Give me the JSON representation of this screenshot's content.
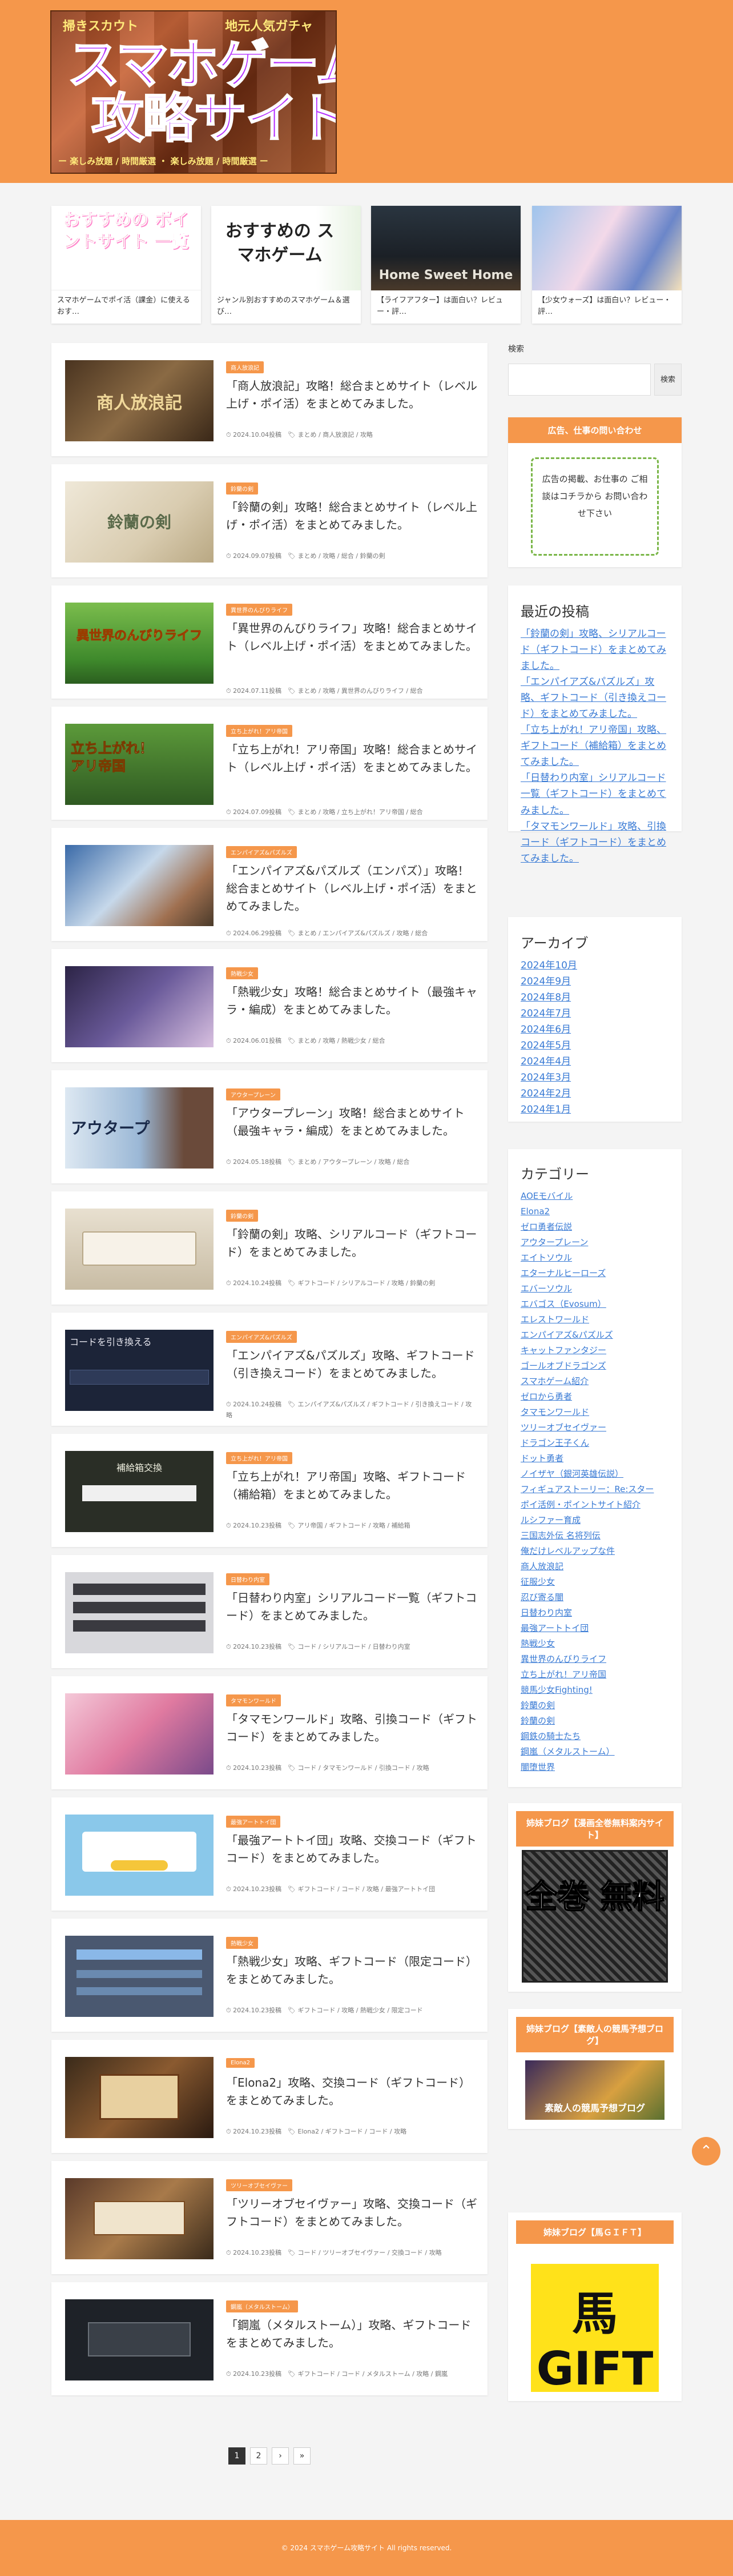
{
  "header": {
    "logo_top_left": "掃きスカウト",
    "logo_top_right": "地元人気ガチャ",
    "logo_title_line1": "スマホゲーム",
    "logo_title_line2": "攻略サイト",
    "logo_bottom": "ー 楽しみ放題 / 時間厳選 ・ 楽しみ放題 / 時間厳選 ー"
  },
  "carousel": [
    {
      "caption": "スマホゲームでポイ活（課金）に使えるおす…",
      "img_text": "おすすめの ポイントサイト 一覧"
    },
    {
      "caption": "ジャンル別おすすめのスマホゲーム＆選び…",
      "img_text": "おすすめの スマホゲーム"
    },
    {
      "caption": "【ライフアフター】は面白い？レビュー・評…",
      "img_text": "Home Sweet Home"
    },
    {
      "caption": "【少女ウォーズ】は面白い？レビュー・評…",
      "img_text": ""
    }
  ],
  "posts": [
    {
      "badge": "商人放浪記",
      "title": "「商人放浪記」攻略！総合まとめサイト（レベル上げ・ポイ活）をまとめてみました。",
      "date": "2024.10.04投稿",
      "tags": "まとめ / 商人放浪記 / 攻略",
      "thumb": "商人放浪記"
    },
    {
      "badge": "鈴蘭の剣",
      "title": "「鈴蘭の剣」攻略！総合まとめサイト（レベル上げ・ポイ活）をまとめてみました。",
      "date": "2024.09.07投稿",
      "tags": "まとめ / 攻略 / 総合 / 鈴蘭の剣",
      "thumb": "鈴蘭の剣"
    },
    {
      "badge": "異世界のんびりライフ",
      "title": "「異世界のんびりライフ」攻略！総合まとめサイト（レベル上げ・ポイ活）をまとめてみました。",
      "date": "2024.07.11投稿",
      "tags": "まとめ / 攻略 / 異世界のんびりライフ / 総合",
      "thumb": "異世界のんびりライフ"
    },
    {
      "badge": "立ち上がれ！アリ帝国",
      "title": "「立ち上がれ！アリ帝国」攻略！総合まとめサイト（レベル上げ・ポイ活）をまとめてみました。",
      "date": "2024.07.09投稿",
      "tags": "まとめ / 攻略 / 立ち上がれ！アリ帝国 / 総合",
      "thumb": "立ち上がれ！アリ帝国"
    },
    {
      "badge": "エンパイアズ&パズルズ",
      "title": "「エンパイアズ&パズルズ（エンパズ）」攻略！総合まとめサイト（レベル上げ・ポイ活）をまとめてみました。",
      "date": "2024.06.29投稿",
      "tags": "まとめ / エンパイアズ&パズルズ / 攻略 / 総合",
      "thumb": ""
    },
    {
      "badge": "熱戦少女",
      "title": "「熱戦少女」攻略！総合まとめサイト（最強キャラ・編成）をまとめてみました。",
      "date": "2024.06.01投稿",
      "tags": "まとめ / 攻略 / 熱戦少女 / 総合",
      "thumb": ""
    },
    {
      "badge": "アウタープレーン",
      "title": "「アウタープレーン」攻略！総合まとめサイト（最強キャラ・編成）をまとめてみました。",
      "date": "2024.05.18投稿",
      "tags": "まとめ / アウタープレーン / 攻略 / 総合",
      "thumb": "アウタープ"
    },
    {
      "badge": "鈴蘭の剣",
      "title": "「鈴蘭の剣」攻略、シリアルコード（ギフトコード）をまとめてみました。",
      "date": "2024.10.24投稿",
      "tags": "ギフトコード / シリアルコード / 攻略 / 鈴蘭の剣",
      "thumb": ""
    },
    {
      "badge": "エンパイアズ&パズルズ",
      "title": "「エンパイアズ&パズルズ」攻略、ギフトコード（引き換えコード）をまとめてみました。",
      "date": "2024.10.24投稿",
      "tags": "エンパイアズ&パズルズ / ギフトコード / 引き換えコード / 攻略",
      "thumb": "コードを引き換える"
    },
    {
      "badge": "立ち上がれ！アリ帝国",
      "title": "「立ち上がれ！アリ帝国」攻略、ギフトコード（補給箱）をまとめてみました。",
      "date": "2024.10.23投稿",
      "tags": "アリ帝国 / ギフトコード / 攻略 / 補給箱",
      "thumb": "補給箱交換"
    },
    {
      "badge": "日替わり内室",
      "title": "「日替わり内室」シリアルコード一覧（ギフトコード）をまとめてみました。",
      "date": "2024.10.23投稿",
      "tags": "コード / シリアルコード / 日替わり内室",
      "thumb": ""
    },
    {
      "badge": "タマモンワールド",
      "title": "「タマモンワールド」攻略、引換コード（ギフトコード）をまとめてみました。",
      "date": "2024.10.23投稿",
      "tags": "コード / タマモンワールド / 引換コード / 攻略",
      "thumb": ""
    },
    {
      "badge": "最強アートトイ団",
      "title": "「最強アートトイ団」攻略、交換コード（ギフトコード）をまとめてみました。",
      "date": "2024.10.23投稿",
      "tags": "ギフトコード / コード / 攻略 / 最強アートトイ団",
      "thumb": ""
    },
    {
      "badge": "熱戦少女",
      "title": "「熱戦少女」攻略、ギフトコード（限定コード）をまとめてみました。",
      "date": "2024.10.23投稿",
      "tags": "ギフトコード / 攻略 / 熱戦少女 / 限定コード",
      "thumb": ""
    },
    {
      "badge": "Elona2",
      "title": "「Elona2」攻略、交換コード（ギフトコード）をまとめてみました。",
      "date": "2024.10.23投稿",
      "tags": "Elona2 / ギフトコード / コード / 攻略",
      "thumb": ""
    },
    {
      "badge": "ツリーオブセイヴァー",
      "title": "「ツリーオブセイヴァー」攻略、交換コード（ギフトコード）をまとめてみました。",
      "date": "2024.10.23投稿",
      "tags": "コード / ツリーオブセイヴァー / 交換コード / 攻略",
      "thumb": ""
    },
    {
      "badge": "鋼嵐（メタルストーム）",
      "title": "「鋼嵐（メタルストーム）」攻略、ギフトコードをまとめてみました。",
      "date": "2024.10.23投稿",
      "tags": "ギフトコード / コード / メタルストーム / 攻略 / 鋼嵐",
      "thumb": ""
    }
  ],
  "sidebar": {
    "search_label": "検索",
    "search_button": "検索",
    "contact_header": "広告、仕事の問い合わせ",
    "contact_text": "広告の掲載、お仕事の ご相談はコチラから お問い合わせ下さい",
    "recent_title": "最近の投稿",
    "recent": [
      "「鈴蘭の剣」攻略、シリアルコード（ギフトコード）をまとめてみました。",
      "「エンパイアズ&パズルズ」攻略、ギフトコード（引き換えコード）をまとめてみました。",
      "「立ち上がれ！アリ帝国」攻略、ギフトコード（補給箱）をまとめてみました。",
      "「日替わり内室」シリアルコード一覧（ギフトコード）をまとめてみました。",
      "「タマモンワールド」攻略、引換コード（ギフトコード）をまとめてみました。"
    ],
    "archive_title": "アーカイブ",
    "archives": [
      "2024年10月",
      "2024年9月",
      "2024年8月",
      "2024年7月",
      "2024年6月",
      "2024年5月",
      "2024年4月",
      "2024年3月",
      "2024年2月",
      "2024年1月"
    ],
    "category_title": "カテゴリー",
    "categories": [
      "AOEモバイル",
      "Elona2",
      "ゼロ勇者伝説",
      "アウタープレーン",
      "エイトソウル",
      "エターナルヒーローズ",
      "エバーソウル",
      "エバゴス（Evosum）",
      "エレストワールド",
      "エンパイアズ&パズルズ",
      "キャットファンタジー",
      "ゴールオブドラゴンズ",
      "スマホゲーム紹介",
      "ゼロから勇者",
      "タマモンワールド",
      "ツリーオブセイヴァー",
      "ドラゴン王子くん",
      "ドット勇者",
      "ノイザヤ（銀河英雄伝説）",
      "フィギュアストーリー：Re:スター",
      "ポイ活例・ポイントサイト紹介",
      "ルシファー育成",
      "三国志外伝 名将列伝",
      "俺だけレベルアップな件",
      "商人放浪記",
      "征服少女",
      "忍び寄る闇",
      "日替わり内室",
      "最強アートトイ団",
      "熱戦少女",
      "異世界のんびりライフ",
      "立ち上がれ！アリ帝国",
      "競馬少女Fighting!",
      "鈴蘭の剣",
      "鈴蘭の剣",
      "鋼鉄の騎士たち",
      "鋼嵐（メタルストーム）",
      "闇堕世界"
    ],
    "blog1_header": "姉妹ブログ【漫画全巻無料案内サイト】",
    "blog1_img": "全巻 無料",
    "blog2_header": "姉妹ブログ【素敵人の競馬予想ブログ】",
    "blog2_img": "素敵人の競馬予想ブログ",
    "blog3_header": "姉妹ブログ【馬ＧＩＦＴ】",
    "blog3_img": "馬 GIFT"
  },
  "pager": [
    "1",
    "2",
    "›",
    "»"
  ],
  "footer": "© 2024 スマホゲーム攻略サイト All rights reserved."
}
